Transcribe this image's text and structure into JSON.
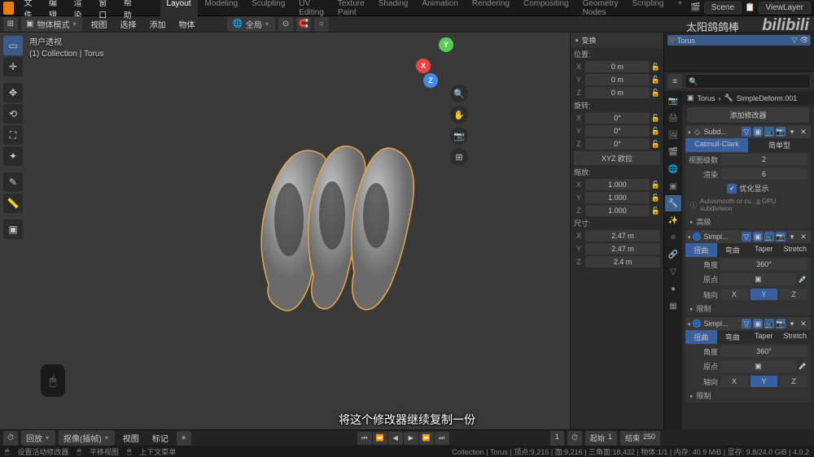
{
  "menu": [
    "文件",
    "编辑",
    "渲染",
    "窗口",
    "帮助"
  ],
  "workspaces": [
    "Layout",
    "Modeling",
    "Sculpting",
    "UV Editing",
    "Texture Paint",
    "Shading",
    "Animation",
    "Rendering",
    "Compositing",
    "Geometry Nodes",
    "Scripting",
    "+"
  ],
  "active_workspace": "Layout",
  "scene_name": "Scene",
  "viewlayer_name": "ViewLayer",
  "header2": {
    "mode": "物体模式",
    "menu2": [
      "视图",
      "选择",
      "添加",
      "物体"
    ],
    "pivot": "全局"
  },
  "viewport_info": {
    "line1": "用户透视",
    "line2": "(1) Collection | Torus"
  },
  "npanel": {
    "header": "变换",
    "location_label": "位置:",
    "location": {
      "X": "0 m",
      "Y": "0 m",
      "Z": "0 m"
    },
    "rotation_label": "旋转:",
    "rotation": {
      "X": "0°",
      "Y": "0°",
      "Z": "0°"
    },
    "rotation_mode": "XYZ 欧拉",
    "scale_label": "缩放:",
    "scale": {
      "X": "1.000",
      "Y": "1.000",
      "Z": "1.000"
    },
    "dimensions_label": "尺寸:",
    "dimensions": {
      "X": "2.47 m",
      "Y": "2.47 m",
      "Z": "2.4 m"
    }
  },
  "outliner": {
    "object": "Torus"
  },
  "breadcrumb": {
    "obj": "Torus",
    "mod": "SimpleDeform.001"
  },
  "add_modifier": "添加修改器",
  "modifiers": {
    "subsurf": {
      "name": "Subd...",
      "algo": [
        "Catmull-Clark",
        "简单型"
      ],
      "viewport_label": "视图级数",
      "viewport": "2",
      "render_label": "渲染",
      "render": "6",
      "optimal": "优化显示",
      "note": "Autosmooth or cu...g GPU subdivision",
      "advanced": "高级"
    },
    "deform1": {
      "name": "Simpl...",
      "tabs": [
        "扭曲",
        "弯曲",
        "Taper",
        "Stretch"
      ],
      "angle_label": "角度",
      "angle": "360°",
      "origin_label": "原点",
      "axis_label": "轴向",
      "axes": [
        "X",
        "Y",
        "Z"
      ],
      "active_axis": "Y",
      "limits": "限制"
    },
    "deform2": {
      "name": "Simpl...",
      "tabs": [
        "扭曲",
        "弯曲",
        "Taper",
        "Stretch"
      ],
      "angle_label": "角度",
      "angle": "360°",
      "origin_label": "原点",
      "axis_label": "轴向",
      "axes": [
        "X",
        "Y",
        "Z"
      ],
      "active_axis": "Y",
      "limits": "限制"
    }
  },
  "timeline": {
    "playback": "回放",
    "keying": "抠像(插帧)",
    "view": "视图",
    "marker": "标记",
    "frame_current": "1",
    "start_label": "起始",
    "start": "1",
    "end_label": "结束",
    "end": "250"
  },
  "statusbar": {
    "left1": "设置活动修改器",
    "left2": "平移视图",
    "left3": "上下文菜单",
    "right": "Collection | Torus | 顶点:9,216 | 面:9,216 | 三角面:18,432 | 物体:1/1 | 内存: 40.9 MiB | 显存: 9.8/24.0 GiB | 4.0.2"
  },
  "subtitle": "将这个修改器继续复制一份",
  "watermark": "bilibili",
  "watermark2": "太阳鸽鸽棒"
}
